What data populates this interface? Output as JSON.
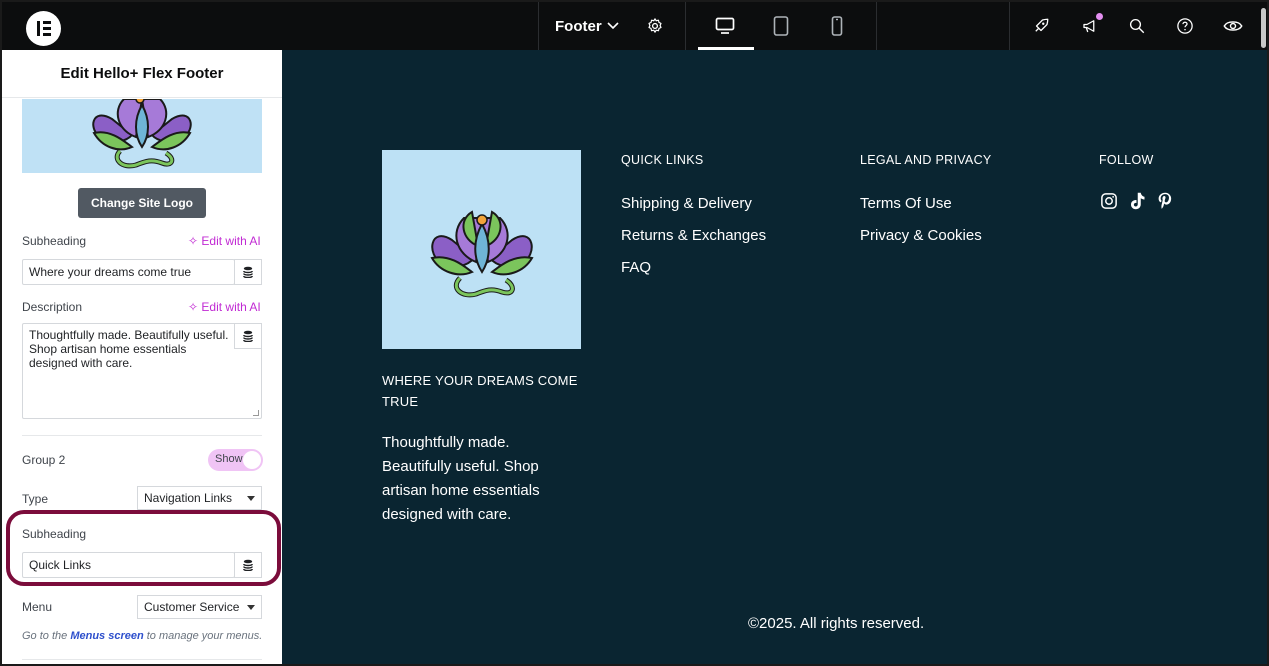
{
  "topbar": {
    "document_title": "Footer",
    "icons": [
      "elementor-logo-icon",
      "chevron-down-icon",
      "gear-icon",
      "desktop-icon",
      "tablet-icon",
      "mobile-icon",
      "rocket-icon",
      "megaphone-icon",
      "search-icon",
      "help-icon",
      "eye-icon"
    ]
  },
  "panel": {
    "title": "Edit Hello+ Flex Footer",
    "change_logo_label": "Change Site Logo",
    "subheading": {
      "label": "Subheading",
      "ai_label": "Edit with AI",
      "value": "Where your dreams come true"
    },
    "description": {
      "label": "Description",
      "ai_label": "Edit with AI",
      "value": "Thoughtfully made. Beautifully useful. Shop artisan home essentials designed with care."
    },
    "group2": {
      "label": "Group 2",
      "toggle_label": "Show",
      "toggle_on": true
    },
    "type": {
      "label": "Type",
      "value": "Navigation Links"
    },
    "group_subheading": {
      "label": "Subheading",
      "value": "Quick Links"
    },
    "menu": {
      "label": "Menu",
      "value": "Customer Service"
    },
    "help": {
      "prefix": "Go to the ",
      "link": "Menus screen",
      "suffix": " to manage your menus."
    }
  },
  "footer": {
    "subheading": "WHERE YOUR DREAMS COME TRUE",
    "description": "Thoughtfully made. Beautifully useful. Shop artisan home essentials designed with care.",
    "columns": [
      {
        "heading": "QUICK LINKS",
        "links": [
          "Shipping & Delivery",
          "Returns & Exchanges",
          "FAQ"
        ]
      },
      {
        "heading": "LEGAL AND PRIVACY",
        "links": [
          "Terms Of Use",
          "Privacy & Cookies"
        ]
      },
      {
        "heading": "FOLLOW",
        "links": []
      }
    ],
    "social_icons": [
      "instagram-icon",
      "tiktok-icon",
      "pinterest-icon"
    ],
    "copyright": "©2025. All rights reserved."
  },
  "colors": {
    "canvas_bg": "#0a2531",
    "topbar_bg": "#0c0d0e",
    "logo_bg": "#bde1f5",
    "ai_accent": "#c12ad3",
    "highlight": "#7b0c3b",
    "toggle_bg": "#f0c4f5"
  }
}
